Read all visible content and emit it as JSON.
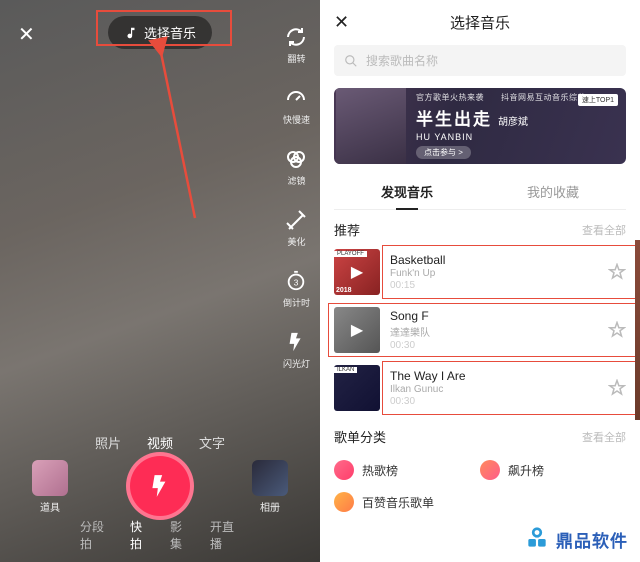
{
  "left": {
    "music_button": "选择音乐",
    "side_tools": [
      {
        "label": "翻转"
      },
      {
        "label": "快慢速"
      },
      {
        "label": "滤镜"
      },
      {
        "label": "美化"
      },
      {
        "label": "倒计时"
      },
      {
        "label": "闪光灯"
      }
    ],
    "mode_tabs": [
      "照片",
      "视频",
      "文字"
    ],
    "mode_active": 1,
    "props_label": "道具",
    "album_label": "相册",
    "bottom_modes": [
      "分段拍",
      "快拍",
      "影集",
      "开直播"
    ],
    "bottom_active": 1
  },
  "right": {
    "title": "选择音乐",
    "search_placeholder": "搜索歌曲名称",
    "banner": {
      "caption_small": "官方歌单火热来袭　　抖音网易互动音乐综艺",
      "headline": "半生出走",
      "artist_en": "HU YANBIN",
      "artist_cn": "胡彦斌",
      "cta": "点击参与 >",
      "tag": "速上TOP1"
    },
    "tabs": [
      "发现音乐",
      "我的收藏"
    ],
    "tab_active": 0,
    "section_reco": "推荐",
    "see_all": "查看全部",
    "songs": [
      {
        "title": "Basketball",
        "artist": "Funk'n Up",
        "duration": "00:15",
        "cover_tag": "PLAYOFF",
        "cover_year": "2018"
      },
      {
        "title": "Song F",
        "artist": "達達樂队",
        "duration": "00:30"
      },
      {
        "title": "The Way I Are",
        "artist": "Ilkan Gunuc",
        "duration": "00:30",
        "cover_tag": "ILKAN"
      }
    ],
    "section_cat": "歌单分类",
    "categories": [
      {
        "label": "热歌榜"
      },
      {
        "label": "飙升榜"
      },
      {
        "label": "百赞音乐歌单"
      }
    ]
  },
  "logo_text": "鼎品软件"
}
